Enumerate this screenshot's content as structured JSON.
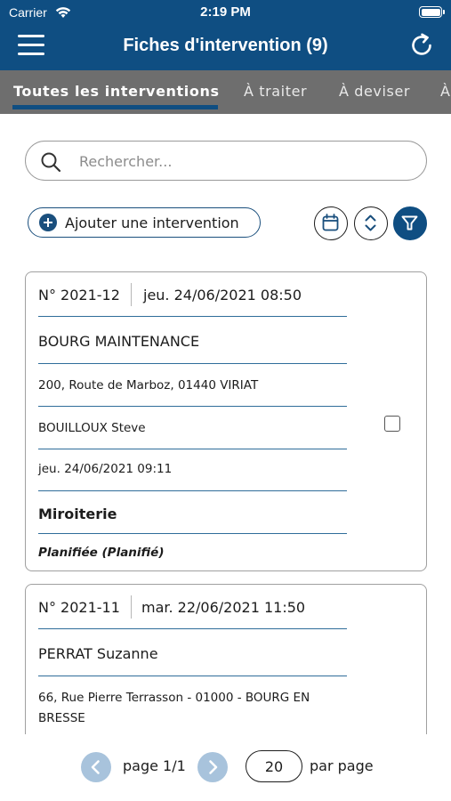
{
  "status_bar": {
    "carrier": "Carrier",
    "time": "2:19 PM"
  },
  "header": {
    "title": "Fiches d'intervention (9)",
    "menu_icon": "hamburger-menu-icon",
    "refresh_icon": "refresh-icon"
  },
  "tabs": [
    {
      "label": "Toutes les interventions",
      "active": true
    },
    {
      "label": "À traiter",
      "active": false
    },
    {
      "label": "À deviser",
      "active": false
    },
    {
      "label": "À",
      "active": false
    }
  ],
  "search": {
    "placeholder": "Rechercher...",
    "value": ""
  },
  "actions": {
    "add_label": "Ajouter une intervention",
    "calendar_icon": "calendar-icon",
    "sort_icon": "sort-icon",
    "filter_icon": "filter-icon"
  },
  "interventions": [
    {
      "number": "N° 2021-12",
      "date": "jeu. 24/06/2021 08:50",
      "client": "BOURG MAINTENANCE",
      "address": "200, Route de Marboz, 01440 VIRIAT",
      "contact": "BOUILLOUX Steve",
      "planned_date": "jeu. 24/06/2021 09:11",
      "type": "Miroiterie",
      "status": "Planifiée (Planifié)",
      "checked": false
    },
    {
      "number": "N° 2021-11",
      "date": "mar. 22/06/2021 11:50",
      "client": "PERRAT Suzanne",
      "address_line1": "66, Rue Pierre Terrasson - 01000 - BOURG EN",
      "address_line2": "BRESSE"
    }
  ],
  "pagination": {
    "page_label": "page 1/1",
    "per_page_value": "20",
    "per_page_label": "par page"
  },
  "colors": {
    "primary": "#0f4e82",
    "tab_bar": "#6e6e6e",
    "pager_button": "#a8c3dc"
  }
}
